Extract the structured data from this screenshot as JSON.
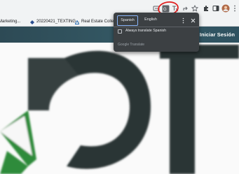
{
  "bookmarks": [
    {
      "label": "Marketing...",
      "icon": "bookmark-favicon"
    },
    {
      "label": "20220421_TEXTING...",
      "icon": "diamond-favicon"
    },
    {
      "label": "Real Estate Collecti...",
      "icon": "triangle-favicon"
    }
  ],
  "site": {
    "login_label": "Iniciar Sesión"
  },
  "translate_popup": {
    "languages": [
      "Spanish",
      "English"
    ],
    "selected_language": "Spanish",
    "always_translate_label": "Always translate Spanish",
    "always_translate_checked": false,
    "footer_label": "Google Translate"
  },
  "colors": {
    "header": "#2f5260",
    "logo_dark": "#2b3a3a",
    "logo_green": "#2e8b3a",
    "popup_bg": "#3c4043",
    "active_tab_border": "#8ab4f8",
    "annotation_circle": "#e02020"
  }
}
